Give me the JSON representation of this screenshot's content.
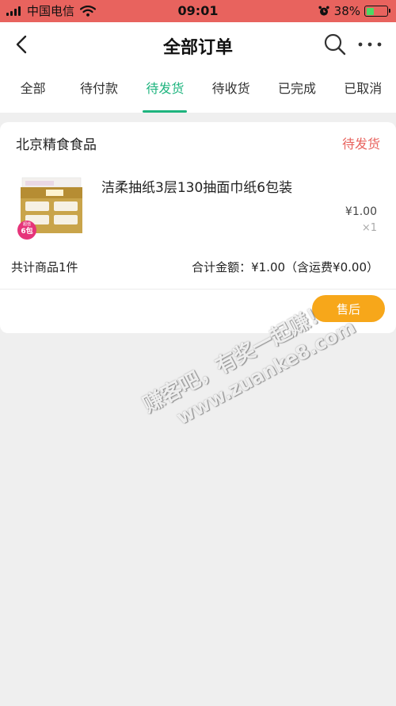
{
  "status_bar": {
    "carrier": "中国电信",
    "time": "09:01",
    "battery_percent": "38%",
    "battery_level": 0.38,
    "color": "#e8635e"
  },
  "nav": {
    "title": "全部订单",
    "icons": [
      "back-arrow-icon",
      "search-icon",
      "more-icon"
    ]
  },
  "tabs": [
    {
      "label": "全部"
    },
    {
      "label": "待付款"
    },
    {
      "label": "待发货",
      "active": true
    },
    {
      "label": "待收货"
    },
    {
      "label": "已完成"
    },
    {
      "label": "已取消"
    }
  ],
  "colors": {
    "accent": "#1eb47e",
    "status": "#e8635e",
    "button": "#f7a71a",
    "background": "#efefef"
  },
  "order": {
    "shop_name": "北京精食食品",
    "status": "待发货",
    "product": {
      "title": "洁柔抽纸3层130抽面巾纸6包装",
      "price": "¥1.00",
      "quantity": "×1",
      "badge": "6包",
      "badge_small": "超值"
    },
    "item_count": "共计商品1件",
    "total": "合计金额：¥1.00（含运费¥0.00）",
    "aftersale_label": "售后"
  },
  "watermark": {
    "line1": "赚客吧，有奖一起赚！",
    "line2": "www.zuanke8.com"
  }
}
